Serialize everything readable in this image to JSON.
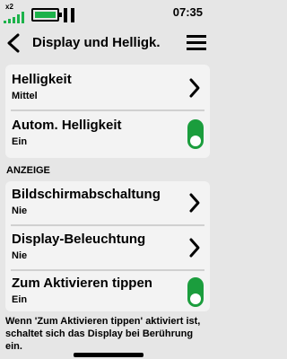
{
  "status": {
    "network_label": "x2",
    "time": "07:35",
    "battery_color": "#1cb24a"
  },
  "header": {
    "title": "Display und Helligk."
  },
  "brightness": {
    "label": "Helligkeit",
    "value": "Mittel"
  },
  "auto_brightness": {
    "label": "Autom. Helligkeit",
    "value": "Ein",
    "on": true
  },
  "section": {
    "title": "ANZEIGE"
  },
  "screen_timeout": {
    "label": "Bildschirmabschaltung",
    "value": "Nie"
  },
  "backlight": {
    "label": "Display-Beleuchtung",
    "value": "Nie"
  },
  "tap_to_wake": {
    "label": "Zum Aktivieren tippen",
    "value": "Ein",
    "on": true
  },
  "footnote": "Wenn 'Zum Aktivieren tippen' aktiviert ist, schaltet sich das Display bei Berührung ein.",
  "colors": {
    "background": "#e6e6e6",
    "card": "#f3f3f3",
    "toggle_on": "#1b9d3d"
  }
}
